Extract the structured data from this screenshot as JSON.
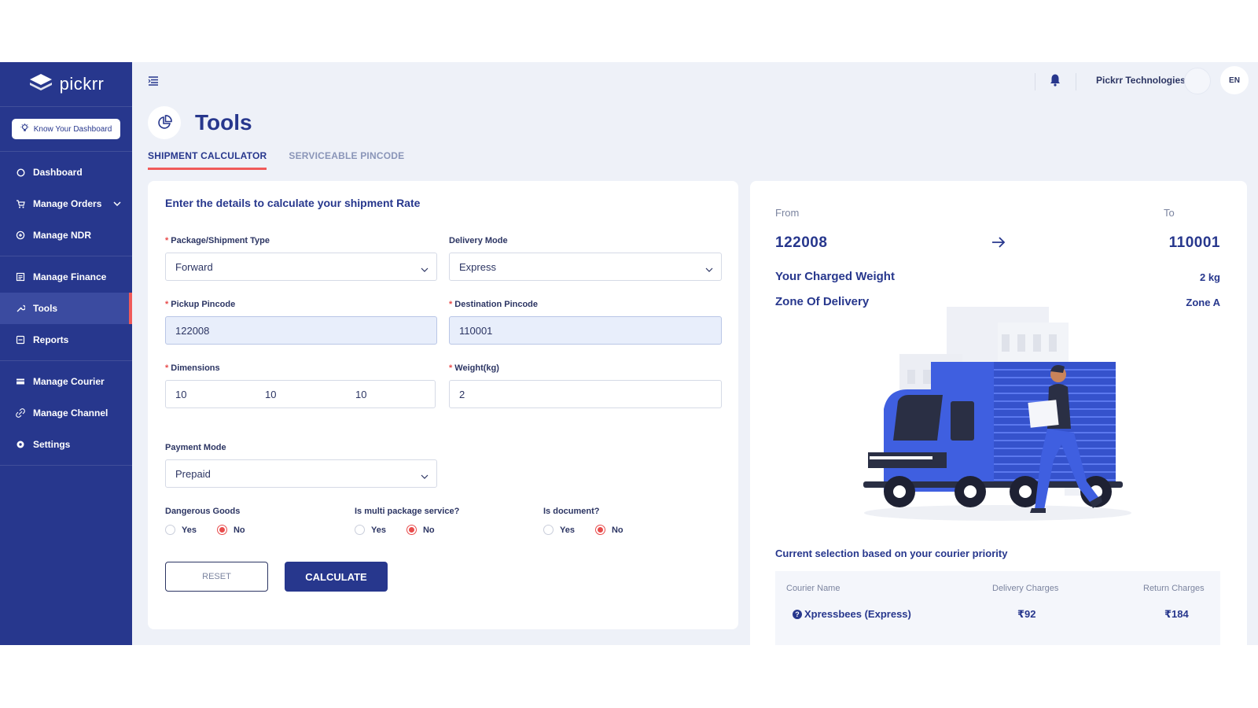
{
  "sidebar": {
    "logo_text": "pickrr",
    "know_dashboard": "Know Your Dashboard",
    "items": [
      {
        "label": "Dashboard",
        "icon": "circle-icon"
      },
      {
        "label": "Manage Orders",
        "icon": "cart-icon"
      },
      {
        "label": "Manage NDR",
        "icon": "ndr-icon"
      },
      {
        "label": "Manage Finance",
        "icon": "finance-icon"
      },
      {
        "label": "Tools",
        "icon": "wrench-icon"
      },
      {
        "label": "Reports",
        "icon": "report-icon"
      },
      {
        "label": "Manage Courier",
        "icon": "courier-icon"
      },
      {
        "label": "Manage Channel",
        "icon": "link-icon"
      },
      {
        "label": "Settings",
        "icon": "gear-icon"
      }
    ]
  },
  "topbar": {
    "company": "Pickrr Technologies",
    "lang": "EN"
  },
  "page": {
    "title": "Tools",
    "tabs": [
      "SHIPMENT CALCULATOR",
      "SERVICEABLE PINCODE"
    ]
  },
  "form": {
    "heading": "Enter the details to calculate your shipment Rate",
    "package_type_label": "Package/Shipment Type",
    "package_type_value": "Forward",
    "delivery_mode_label": "Delivery Mode",
    "delivery_mode_value": "Express",
    "pickup_label": "Pickup Pincode",
    "pickup_value": "122008",
    "destination_label": "Destination Pincode",
    "destination_value": "110001",
    "dimensions_label": "Dimensions",
    "dim_l": "10",
    "dim_b": "10",
    "dim_h": "10",
    "weight_label": "Weight(kg)",
    "weight_value": "2",
    "payment_label": "Payment Mode",
    "payment_value": "Prepaid",
    "dangerous_label": "Dangerous Goods",
    "multi_label": "Is multi package service?",
    "document_label": "Is document?",
    "yes": "Yes",
    "no": "No",
    "reset": "RESET",
    "calculate": "CALCULATE"
  },
  "result": {
    "from_label": "From",
    "to_label": "To",
    "from_pin": "122008",
    "to_pin": "110001",
    "charged_weight_label": "Your Charged Weight",
    "charged_weight_value": "2 kg",
    "zone_label": "Zone Of Delivery",
    "zone_value": "Zone A",
    "priority_heading": "Current selection based on your courier priority",
    "table": {
      "headers": [
        "Courier Name",
        "Delivery Charges",
        "Return Charges"
      ],
      "row": {
        "courier": "Xpressbees (Express)",
        "delivery": "₹92",
        "return": "₹184"
      }
    }
  },
  "colors": {
    "primary": "#27378d",
    "accent": "#f05a5a",
    "truck_blue": "#3f5fe0"
  }
}
